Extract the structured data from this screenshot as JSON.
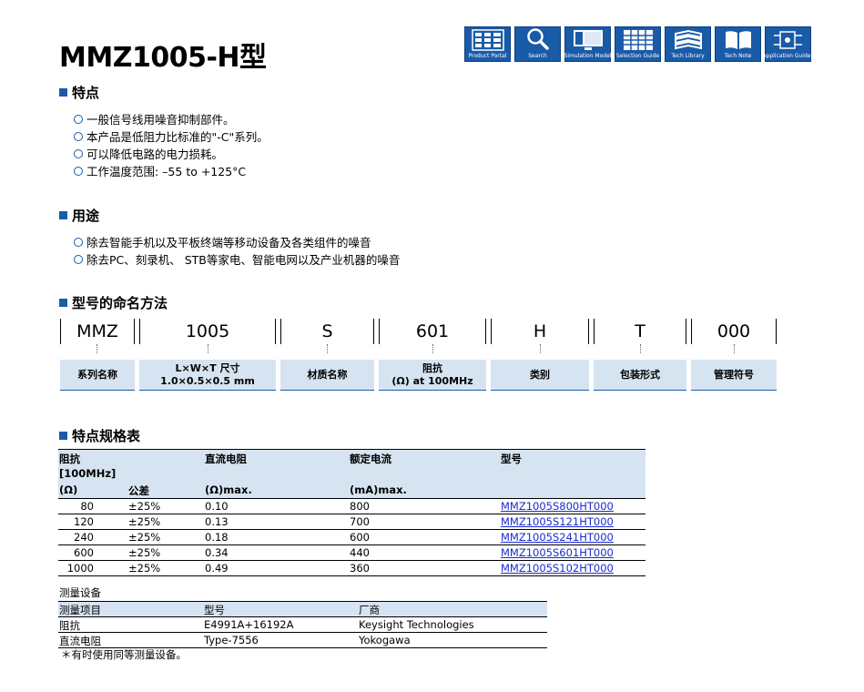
{
  "title": "MMZ1005-H型",
  "toolbar": [
    {
      "label": "Product Portal",
      "icon": "product-portal-icon"
    },
    {
      "label": "Search",
      "icon": "search-icon"
    },
    {
      "label": "Simulation Model",
      "icon": "simulation-model-icon"
    },
    {
      "label": "Selection Guide",
      "icon": "selection-guide-icon"
    },
    {
      "label": "Tech Library",
      "icon": "tech-library-icon"
    },
    {
      "label": "Tech Note",
      "icon": "tech-note-icon"
    },
    {
      "label": "Application Guides",
      "icon": "application-guides-icon"
    }
  ],
  "features": {
    "heading": "特点",
    "items": [
      "一般信号线用噪音抑制部件。",
      "本产品是低阻力比标准的\"-C\"系列。",
      "可以降低电路的电力损耗。",
      "工作温度范围: –55 to +125°C"
    ]
  },
  "applications": {
    "heading": "用途",
    "items": [
      "除去智能手机以及平板终端等移动设备及各类组件的噪音",
      "除去PC、刻录机、 STB等家电、智能电网以及产业机器的噪音"
    ]
  },
  "naming": {
    "heading": "型号的命名方法",
    "codes": [
      "MMZ",
      "1005",
      "S",
      "601",
      "H",
      "T",
      "000"
    ],
    "captions": [
      [
        "系列名称"
      ],
      [
        "L×W×T 尺寸",
        "1.0×0.5×0.5 mm"
      ],
      [
        "材质名称"
      ],
      [
        "阻抗",
        "(Ω) at 100MHz"
      ],
      [
        "类别"
      ],
      [
        "包装形式"
      ],
      [
        "管理符号"
      ]
    ]
  },
  "spec": {
    "heading": "特点规格表",
    "header": {
      "impedance_l1": "阻抗",
      "impedance_l2": "[100MHz]",
      "impedance_l3": "(Ω)",
      "tolerance": "公差",
      "dcr_l1": "直流电阻",
      "dcr_l2": "(Ω)max.",
      "current_l1": "额定电流",
      "current_l2": "(mA)max.",
      "part": "型号"
    },
    "rows": [
      {
        "impedance": "80",
        "tolerance": "±25%",
        "dcr": "0.10",
        "current": "800",
        "part": "MMZ1005S800HT000"
      },
      {
        "impedance": "120",
        "tolerance": "±25%",
        "dcr": "0.13",
        "current": "700",
        "part": "MMZ1005S121HT000"
      },
      {
        "impedance": "240",
        "tolerance": "±25%",
        "dcr": "0.18",
        "current": "600",
        "part": "MMZ1005S241HT000"
      },
      {
        "impedance": "600",
        "tolerance": "±25%",
        "dcr": "0.34",
        "current": "440",
        "part": "MMZ1005S601HT000"
      },
      {
        "impedance": "1000",
        "tolerance": "±25%",
        "dcr": "0.49",
        "current": "360",
        "part": "MMZ1005S102HT000"
      }
    ]
  },
  "measurement": {
    "heading": "测量设备",
    "columns": [
      "测量项目",
      "型号",
      "厂商"
    ],
    "rows": [
      [
        "阻抗",
        "E4991A+16192A",
        "Keysight Technologies"
      ],
      [
        "直流电阻",
        "Type-7556",
        "Yokogawa"
      ]
    ],
    "note": "＊有时使用同等测量设备。"
  },
  "colors": {
    "accent": "#1a5ba8",
    "header_bg": "#d6e4f1",
    "link": "#1a2bd1"
  }
}
